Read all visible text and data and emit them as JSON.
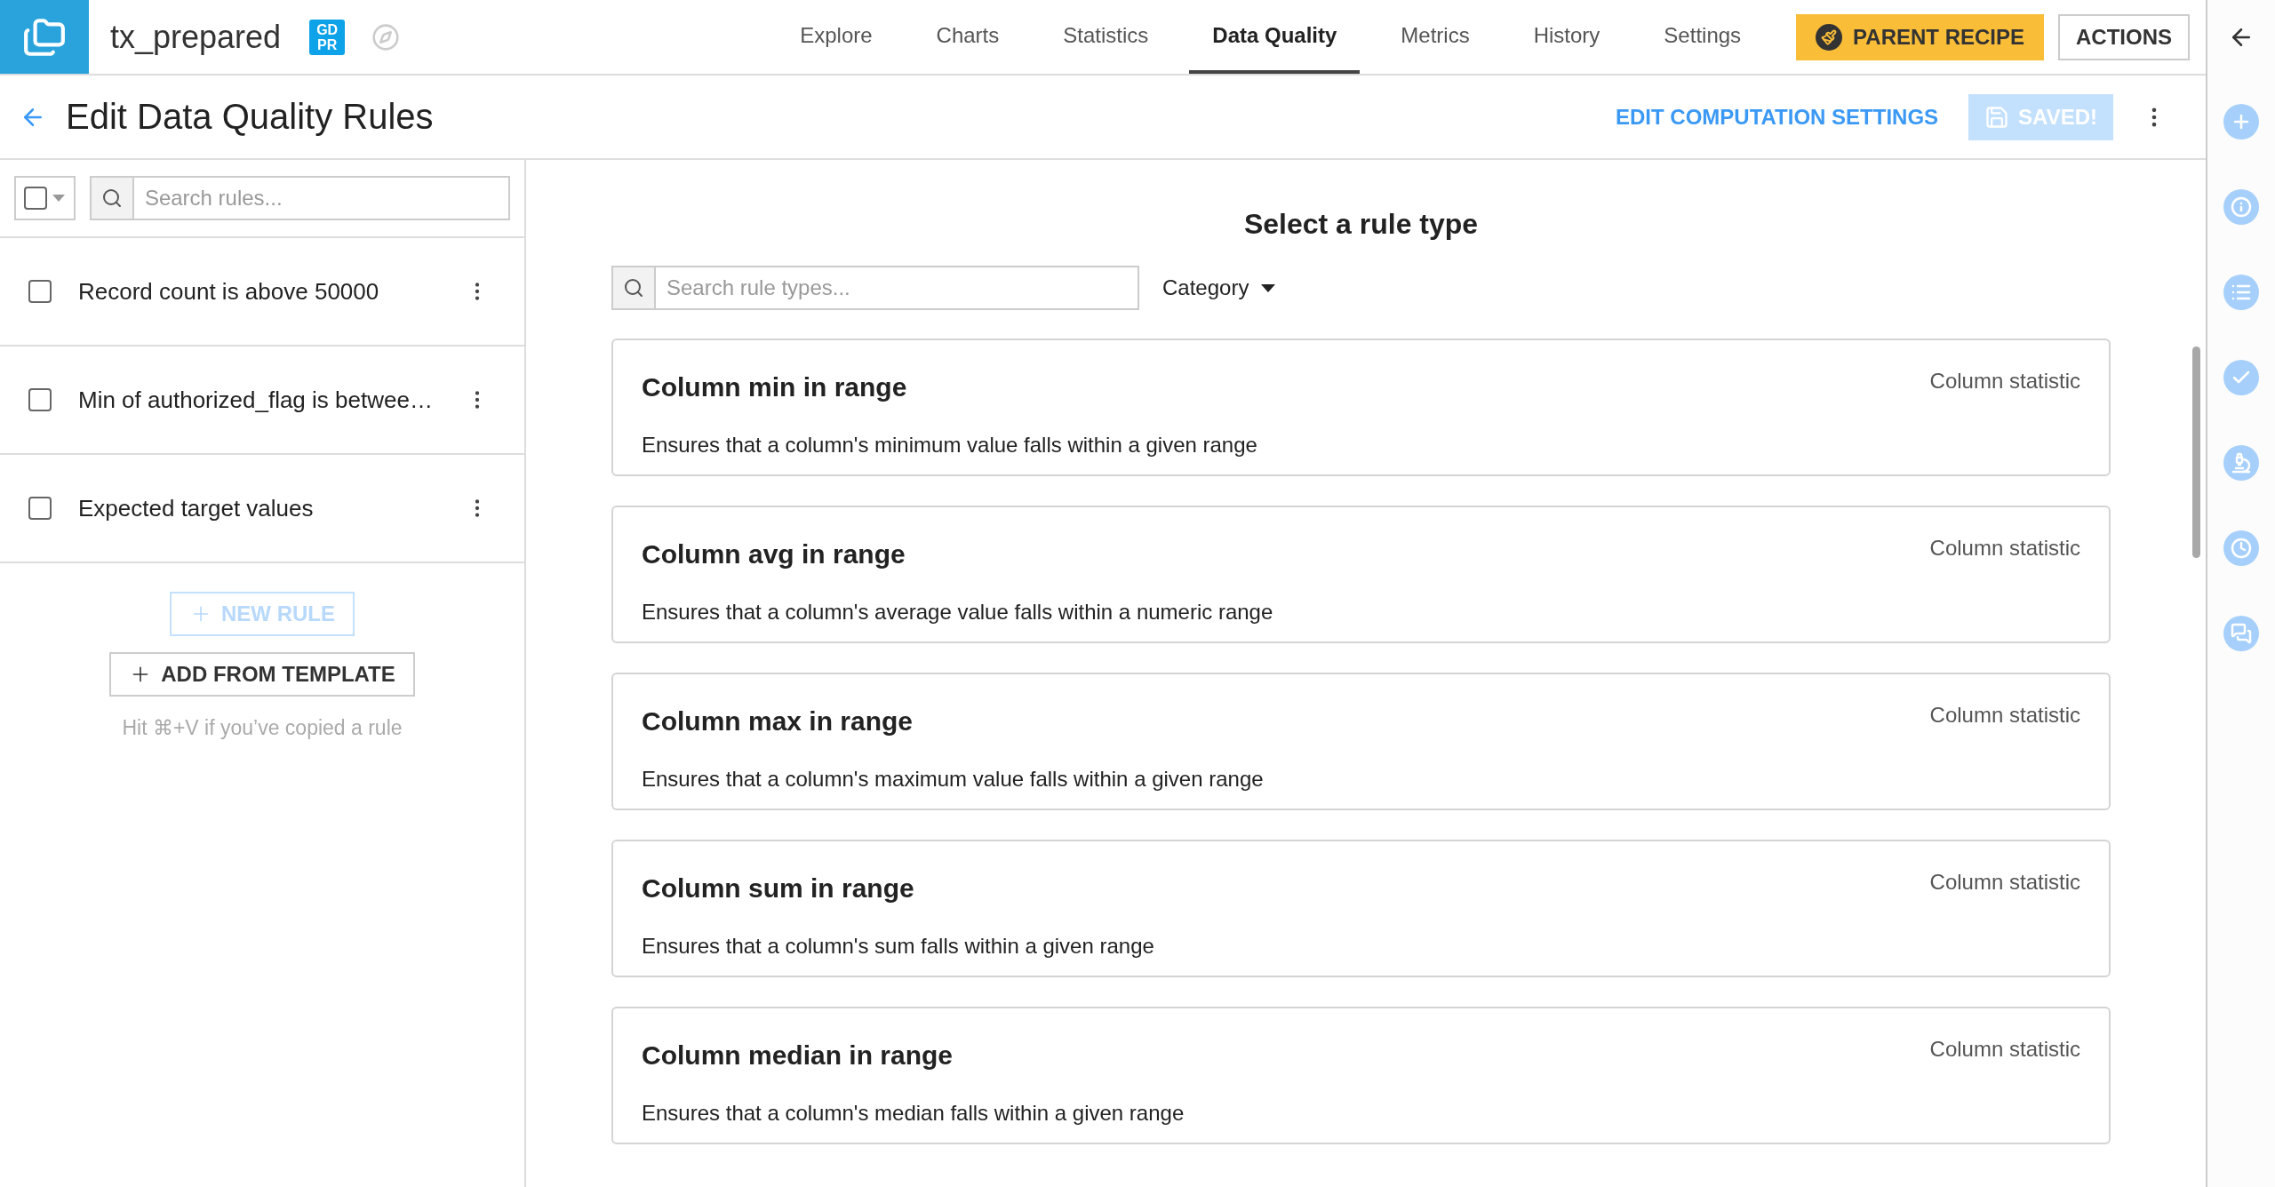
{
  "dataset": {
    "name": "tx_prepared",
    "badge_lines": [
      "GD",
      "PR"
    ]
  },
  "nav_tabs": [
    {
      "label": "Explore",
      "selected": false
    },
    {
      "label": "Charts",
      "selected": false
    },
    {
      "label": "Statistics",
      "selected": false
    },
    {
      "label": "Data Quality",
      "selected": true
    },
    {
      "label": "Metrics",
      "selected": false
    },
    {
      "label": "History",
      "selected": false
    },
    {
      "label": "Settings",
      "selected": false
    }
  ],
  "parent_recipe_button": "PARENT RECIPE",
  "actions_button": "ACTIONS",
  "page": {
    "title": "Edit Data Quality Rules",
    "edit_computation_link": "EDIT COMPUTATION SETTINGS",
    "save_button": {
      "label": "SAVED!",
      "disabled": true
    }
  },
  "rules_panel": {
    "select_all_checked": false,
    "search": {
      "placeholder": "Search rules..."
    },
    "rules": [
      {
        "label": "Record count is above 50000",
        "checked": false
      },
      {
        "label": "Min of authorized_flag is betwee…",
        "checked": false
      },
      {
        "label": "Expected target values",
        "checked": false
      }
    ],
    "new_rule_button": {
      "label": "NEW RULE",
      "disabled": true
    },
    "add_from_template_button": "ADD FROM TEMPLATE",
    "hint": "Hit ⌘+V if you’ve copied a rule"
  },
  "rule_types": {
    "heading": "Select a rule type",
    "search": {
      "placeholder": "Search rule types..."
    },
    "category_filter": "Category",
    "items": [
      {
        "title": "Column min in range",
        "description": "Ensures that a column's minimum value falls within a given range",
        "category": "Column statistic"
      },
      {
        "title": "Column avg in range",
        "description": "Ensures that a column's average value falls within a numeric range",
        "category": "Column statistic"
      },
      {
        "title": "Column max in range",
        "description": "Ensures that a column's maximum value falls within a given range",
        "category": "Column statistic"
      },
      {
        "title": "Column sum in range",
        "description": "Ensures that a column's sum falls within a given range",
        "category": "Column statistic"
      },
      {
        "title": "Column median in range",
        "description": "Ensures that a column's median falls within a given range",
        "category": "Column statistic"
      }
    ]
  }
}
